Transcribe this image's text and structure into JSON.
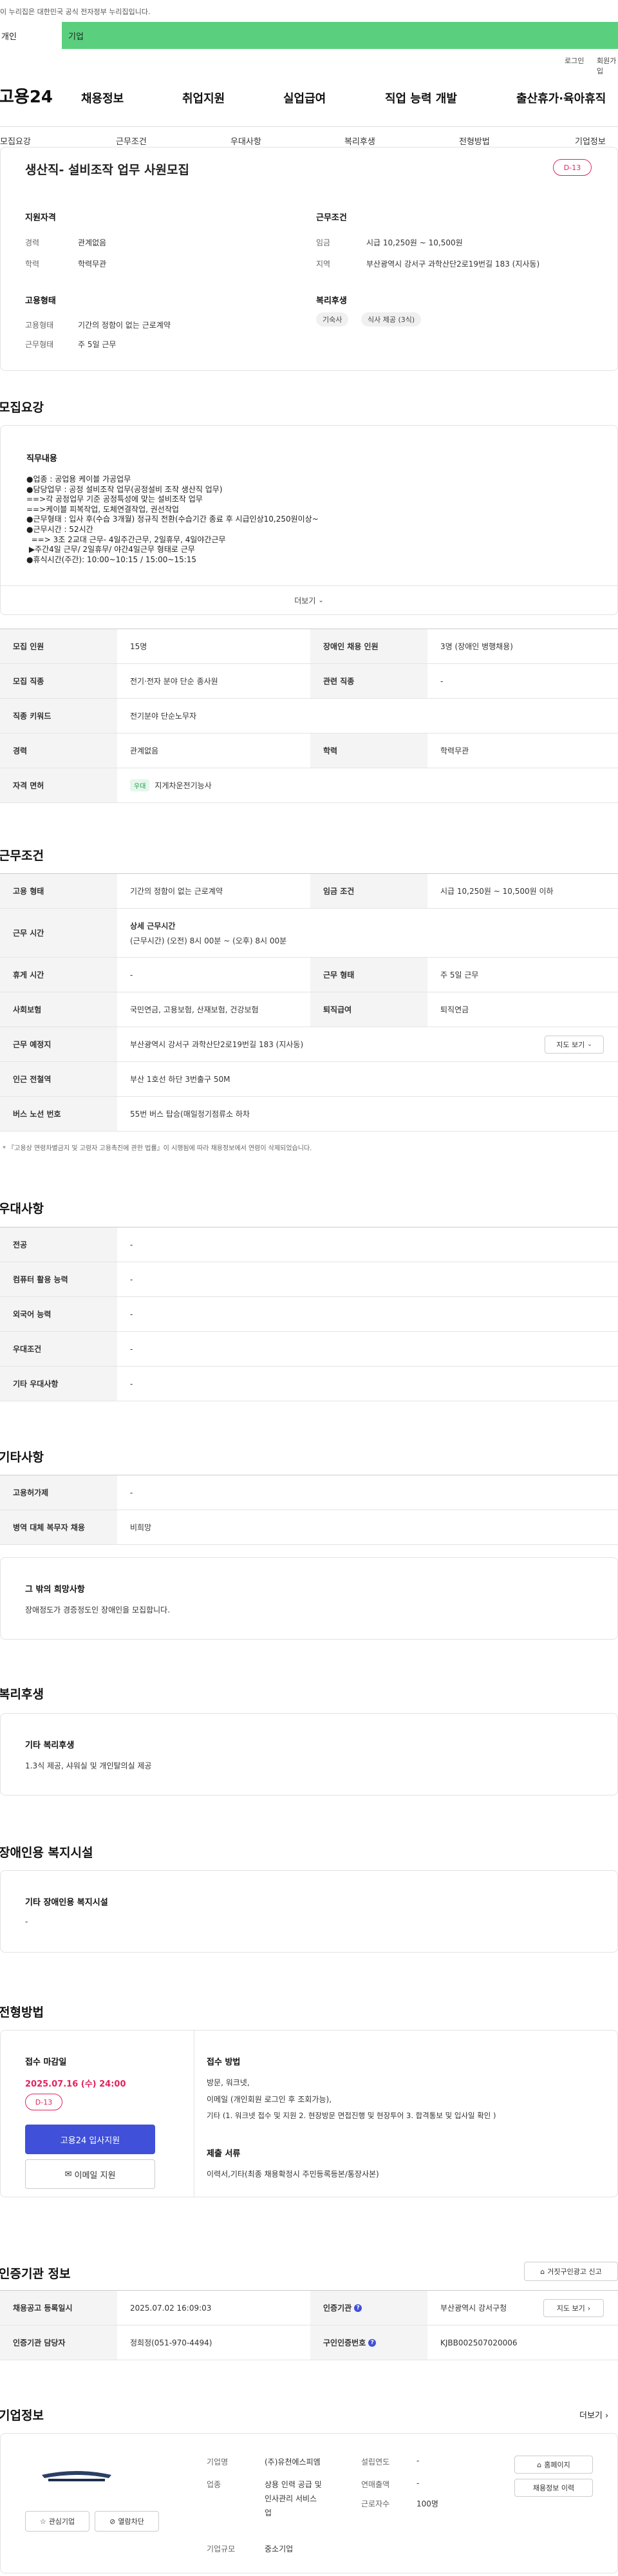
{
  "top_notice": "이 누리집은 대한민국 공식 전자정부 누리집입니다.",
  "audience_tabs": [
    "개인",
    "기업"
  ],
  "util": {
    "login": "로그인",
    "signup": "회원가입"
  },
  "gnb": {
    "logo": "고용24",
    "menus": [
      "채용정보",
      "취업지원",
      "실업급여",
      "직업 능력 개발",
      "출산휴가·육아휴직"
    ]
  },
  "lnb": [
    "모집요강",
    "근무조건",
    "우대사항",
    "복리후생",
    "전형방법",
    "기업정보"
  ],
  "summary": {
    "title": "생산직- 설비조작 업무 사원모집",
    "dday": "D-13",
    "qual_title": "지원자격",
    "career_label": "경력",
    "career_value": "관계없음",
    "edu_label": "학력",
    "edu_value": "학력무관",
    "cond_title": "근무조건",
    "wage_label": "임금",
    "wage_value": "시급 10,250원 ~ 10,500원",
    "region_label": "지역",
    "region_value": "부산광역시 강서구 과학산단2로19번길 183 (지사동)",
    "emp_title": "고용형태",
    "emp_type_label": "고용형태",
    "emp_type_value": "기간의 정함이 없는 근로계약",
    "work_type_label": "근무형태",
    "work_type_value": "주 5일 근무",
    "welfare_title": "복리후생",
    "welfare_chips": [
      "기숙사",
      "식사 제공 (3식)"
    ]
  },
  "recruit": {
    "section_title": "모집요강",
    "duty_title": "직무내용",
    "duty_lines": [
      "●업종 : 공업용 케이블 가공업무",
      "●담당업무 : 공정 설비조작 업무(공정설비 조작 생산직 업무)",
      "==>각 공정업무 기준 공정특성에 맞는 설비조작 업무",
      "==>케이블 피복작업, 도체연결작업, 권선작업",
      "●근무형태 : 입사 후(수습 3개월) 정규직 전환(수습기간 종료 후 시급인상10,250원이상~",
      "●근무시간 : 52시간",
      "  ==> 3조 2교대 근무- 4일주간근무, 2일휴무, 4일야간근무",
      " ▶주간4일 근무/ 2일휴무/ 야간4일근무 형태로 근무",
      "●휴식시간(주간): 10:00~10:15 / 15:00~15:15"
    ],
    "more": "더보기",
    "rows": [
      {
        "l1": "모집 인원",
        "v1": "15명",
        "l2": "장애인 채용 인원",
        "v2": "3명 (장애인 병행채용)"
      },
      {
        "l1": "모집 직종",
        "v1": "전기·전자 분야 단순 종사원",
        "l2": "관련 직종",
        "v2": "-"
      },
      {
        "l1": "직종 키워드",
        "v1": "전기분야 단순노무자"
      },
      {
        "l1": "경력",
        "v1": "관계없음",
        "l2": "학력",
        "v2": "학력무관"
      },
      {
        "l1": "자격 면허",
        "badge": "우대",
        "v1": "지게차운전기능사"
      }
    ]
  },
  "conditions": {
    "section_title": "근무조건",
    "rows": [
      {
        "l1": "고용 형태",
        "v1": "기간의 정함이 없는 근로계약",
        "l2": "임금 조건",
        "v2": "시급 10,250원 ~ 10,500원 이하"
      },
      {
        "l1": "근무 시간",
        "v1a": "상세 근무시간",
        "v1b": "(근무시간) (오전) 8시 00분 ~ (오후) 8시 00분"
      },
      {
        "l1": "휴게 시간",
        "v1": "-",
        "l2": "근무 형태",
        "v2": "주 5일 근무"
      },
      {
        "l1": "사회보험",
        "v1": "국민연금, 고용보험, 산재보험, 건강보험",
        "l2": "퇴직급여",
        "v2": "퇴직연금"
      },
      {
        "l1": "근무 예정지",
        "v1": "부산광역시 강서구 과학산단2로19번길 183 (지사동)",
        "btn": "지도 보기"
      },
      {
        "l1": "인근 전철역",
        "v1": "부산 1호선 하단 3번출구 50M"
      },
      {
        "l1": "버스 노선 번호",
        "v1": "55번 버스 탑승(매일정기점류소 하차"
      }
    ],
    "footnote": "* 『고용상 연령차별금지 및 고령자 고용촉진에 관한 법률』이 시행됨에 따라 채용정보에서 연령이 삭제되었습니다."
  },
  "preferences": {
    "section_title": "우대사항",
    "rows": [
      {
        "l": "전공",
        "v": "-"
      },
      {
        "l": "컴퓨터 활용 능력",
        "v": "-"
      },
      {
        "l": "외국어 능력",
        "v": "-"
      },
      {
        "l": "우대조건",
        "v": "-"
      },
      {
        "l": "기타 우대사항",
        "v": "-"
      }
    ]
  },
  "etc": {
    "section_title": "기타사항",
    "rows": [
      {
        "l": "고용허가제",
        "v": "-"
      },
      {
        "l": "병역 대체 복무자 채용",
        "v": "비희망"
      }
    ],
    "box_title": "그 밖의 희망사항",
    "box_text": "장애정도가 경증정도인 장애인을 모집합니다."
  },
  "welfare": {
    "section_title": "복리후생",
    "box_title": "기타 복리후생",
    "box_text": "1.3식 제공, 샤워실 및 개인탈의실 제공"
  },
  "disability": {
    "section_title": "장애인용 복지시설",
    "box_title": "기타 장애인용 복지시설",
    "box_text": "-"
  },
  "process": {
    "section_title": "전형방법",
    "deadline_label": "접수 마감일",
    "deadline": "2025.07.16 (수) 24:00",
    "dday": "D-13",
    "apply_btn": "고용24 입사지원",
    "email_btn": "이메일 지원",
    "method_title": "접수 방법",
    "method_lines": [
      "방문, 워크넷,",
      "이메일 (개인회원 로그인 후 조회가능),",
      "기타 (1. 워크넷 접수 및 지원 2. 현장방문 면접진행 및 현장투어 3. 합격통보 및 입사일 확인 )"
    ],
    "docs_title": "제출 서류",
    "docs_text": "이력서,기타(최종 채용확정시 주민등록등본/통장사본)"
  },
  "agency": {
    "section_title": "인증기관 정보",
    "report_btn": "거짓구인광고 신고",
    "rows": [
      {
        "l1": "채용공고 등록일시",
        "v1": "2025.07.02 16:09:03",
        "l2": "인증기관",
        "v2": "부산광역시 강서구청",
        "btn": "지도 보기"
      },
      {
        "l1": "인증기관 담당자",
        "v1": "정희정(051-970-4494)",
        "l2": "구인인증번호",
        "v2": "KJBB002507020006"
      }
    ]
  },
  "company": {
    "section_title": "기업정보",
    "more": "더보기",
    "interest_btn": "관심기업",
    "block_btn": "열람차단",
    "name_label": "기업명",
    "name_value": "(주)유천에스피엠",
    "industry_label": "업종",
    "industry_lines": [
      "상용 인력 공급 및",
      "인사관리 서비스",
      "업"
    ],
    "size_label": "기업규모",
    "size_value": "중소기업",
    "founded_label": "설립연도",
    "founded_value": "-",
    "revenue_label": "연매출액",
    "revenue_value": "-",
    "staff_label": "근로자수",
    "staff_value": "100명",
    "homepage_btn": "홈페이지",
    "jobs_btn": "채용정보 이력"
  }
}
